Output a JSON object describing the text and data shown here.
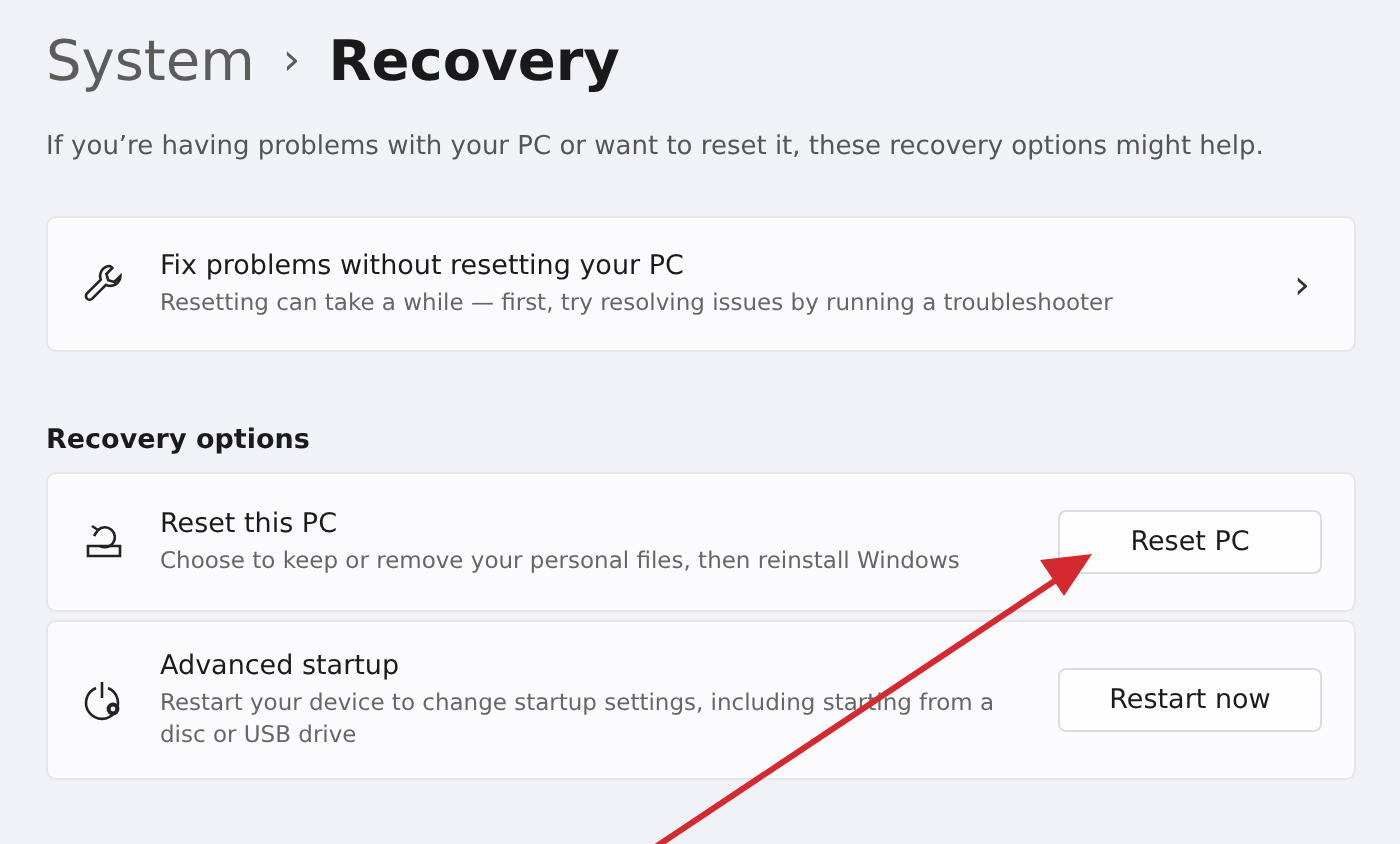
{
  "breadcrumb": {
    "parent": "System",
    "separator": "›",
    "current": "Recovery"
  },
  "description": "If you’re having problems with your PC or want to reset it, these recovery options might help.",
  "fix_card": {
    "title": "Fix problems without resetting your PC",
    "subtitle": "Resetting can take a while — first, try resolving issues by running a troubleshooter",
    "chevron": "›"
  },
  "section_title": "Recovery options",
  "options": [
    {
      "kind": "reset",
      "title": "Reset this PC",
      "subtitle": "Choose to keep or remove your personal files, then reinstall Windows",
      "button": "Reset PC"
    },
    {
      "kind": "startup",
      "title": "Advanced startup",
      "subtitle": "Restart your device to change startup settings, including starting from a disc or USB drive",
      "button": "Restart now"
    }
  ]
}
